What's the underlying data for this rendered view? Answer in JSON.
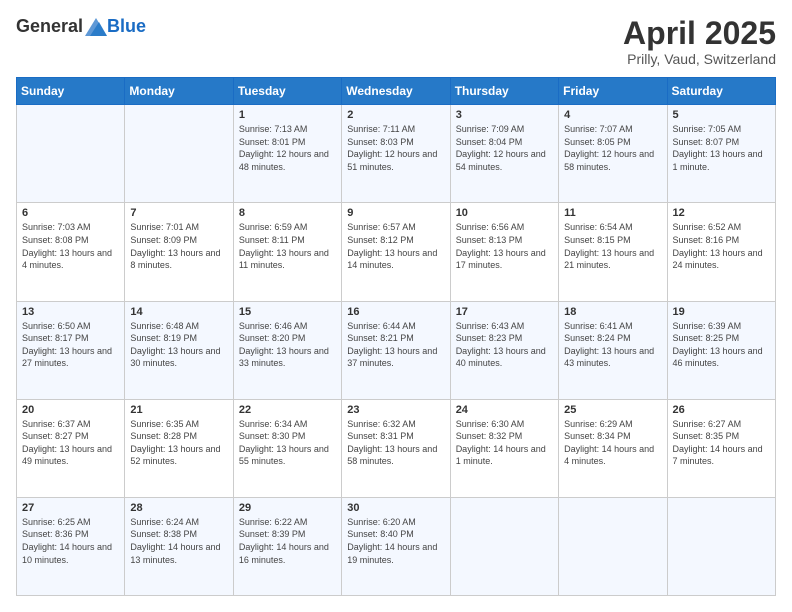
{
  "header": {
    "logo": {
      "general": "General",
      "blue": "Blue"
    },
    "title": "April 2025",
    "subtitle": "Prilly, Vaud, Switzerland"
  },
  "calendar": {
    "days_of_week": [
      "Sunday",
      "Monday",
      "Tuesday",
      "Wednesday",
      "Thursday",
      "Friday",
      "Saturday"
    ],
    "weeks": [
      [
        {
          "day": "",
          "info": ""
        },
        {
          "day": "",
          "info": ""
        },
        {
          "day": "1",
          "info": "Sunrise: 7:13 AM\nSunset: 8:01 PM\nDaylight: 12 hours and 48 minutes."
        },
        {
          "day": "2",
          "info": "Sunrise: 7:11 AM\nSunset: 8:03 PM\nDaylight: 12 hours and 51 minutes."
        },
        {
          "day": "3",
          "info": "Sunrise: 7:09 AM\nSunset: 8:04 PM\nDaylight: 12 hours and 54 minutes."
        },
        {
          "day": "4",
          "info": "Sunrise: 7:07 AM\nSunset: 8:05 PM\nDaylight: 12 hours and 58 minutes."
        },
        {
          "day": "5",
          "info": "Sunrise: 7:05 AM\nSunset: 8:07 PM\nDaylight: 13 hours and 1 minute."
        }
      ],
      [
        {
          "day": "6",
          "info": "Sunrise: 7:03 AM\nSunset: 8:08 PM\nDaylight: 13 hours and 4 minutes."
        },
        {
          "day": "7",
          "info": "Sunrise: 7:01 AM\nSunset: 8:09 PM\nDaylight: 13 hours and 8 minutes."
        },
        {
          "day": "8",
          "info": "Sunrise: 6:59 AM\nSunset: 8:11 PM\nDaylight: 13 hours and 11 minutes."
        },
        {
          "day": "9",
          "info": "Sunrise: 6:57 AM\nSunset: 8:12 PM\nDaylight: 13 hours and 14 minutes."
        },
        {
          "day": "10",
          "info": "Sunrise: 6:56 AM\nSunset: 8:13 PM\nDaylight: 13 hours and 17 minutes."
        },
        {
          "day": "11",
          "info": "Sunrise: 6:54 AM\nSunset: 8:15 PM\nDaylight: 13 hours and 21 minutes."
        },
        {
          "day": "12",
          "info": "Sunrise: 6:52 AM\nSunset: 8:16 PM\nDaylight: 13 hours and 24 minutes."
        }
      ],
      [
        {
          "day": "13",
          "info": "Sunrise: 6:50 AM\nSunset: 8:17 PM\nDaylight: 13 hours and 27 minutes."
        },
        {
          "day": "14",
          "info": "Sunrise: 6:48 AM\nSunset: 8:19 PM\nDaylight: 13 hours and 30 minutes."
        },
        {
          "day": "15",
          "info": "Sunrise: 6:46 AM\nSunset: 8:20 PM\nDaylight: 13 hours and 33 minutes."
        },
        {
          "day": "16",
          "info": "Sunrise: 6:44 AM\nSunset: 8:21 PM\nDaylight: 13 hours and 37 minutes."
        },
        {
          "day": "17",
          "info": "Sunrise: 6:43 AM\nSunset: 8:23 PM\nDaylight: 13 hours and 40 minutes."
        },
        {
          "day": "18",
          "info": "Sunrise: 6:41 AM\nSunset: 8:24 PM\nDaylight: 13 hours and 43 minutes."
        },
        {
          "day": "19",
          "info": "Sunrise: 6:39 AM\nSunset: 8:25 PM\nDaylight: 13 hours and 46 minutes."
        }
      ],
      [
        {
          "day": "20",
          "info": "Sunrise: 6:37 AM\nSunset: 8:27 PM\nDaylight: 13 hours and 49 minutes."
        },
        {
          "day": "21",
          "info": "Sunrise: 6:35 AM\nSunset: 8:28 PM\nDaylight: 13 hours and 52 minutes."
        },
        {
          "day": "22",
          "info": "Sunrise: 6:34 AM\nSunset: 8:30 PM\nDaylight: 13 hours and 55 minutes."
        },
        {
          "day": "23",
          "info": "Sunrise: 6:32 AM\nSunset: 8:31 PM\nDaylight: 13 hours and 58 minutes."
        },
        {
          "day": "24",
          "info": "Sunrise: 6:30 AM\nSunset: 8:32 PM\nDaylight: 14 hours and 1 minute."
        },
        {
          "day": "25",
          "info": "Sunrise: 6:29 AM\nSunset: 8:34 PM\nDaylight: 14 hours and 4 minutes."
        },
        {
          "day": "26",
          "info": "Sunrise: 6:27 AM\nSunset: 8:35 PM\nDaylight: 14 hours and 7 minutes."
        }
      ],
      [
        {
          "day": "27",
          "info": "Sunrise: 6:25 AM\nSunset: 8:36 PM\nDaylight: 14 hours and 10 minutes."
        },
        {
          "day": "28",
          "info": "Sunrise: 6:24 AM\nSunset: 8:38 PM\nDaylight: 14 hours and 13 minutes."
        },
        {
          "day": "29",
          "info": "Sunrise: 6:22 AM\nSunset: 8:39 PM\nDaylight: 14 hours and 16 minutes."
        },
        {
          "day": "30",
          "info": "Sunrise: 6:20 AM\nSunset: 8:40 PM\nDaylight: 14 hours and 19 minutes."
        },
        {
          "day": "",
          "info": ""
        },
        {
          "day": "",
          "info": ""
        },
        {
          "day": "",
          "info": ""
        }
      ]
    ]
  }
}
